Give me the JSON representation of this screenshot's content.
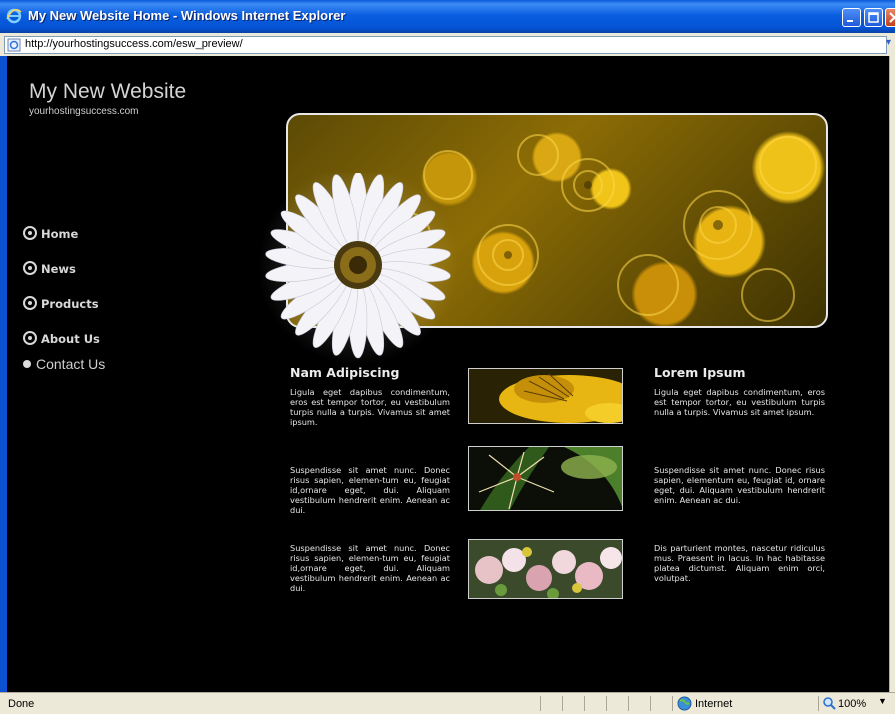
{
  "browser": {
    "window_title": "My New Website Home - Windows Internet Explorer",
    "address_url": "http://yourhostingsuccess.com/esw_preview/",
    "status_text": "Done",
    "zone_text": "Internet",
    "zoom_text": "100%"
  },
  "site": {
    "title": "My New Website",
    "subtitle": "yourhostingsuccess.com",
    "nav": [
      {
        "label": "Home"
      },
      {
        "label": "News"
      },
      {
        "label": "Products"
      },
      {
        "label": "About Us"
      }
    ],
    "subnav": [
      {
        "label": "Contact Us"
      }
    ],
    "left_column": {
      "heading": "Nam Adipiscing",
      "paragraphs": [
        "Ligula eget dapibus condimentum, eros est tempor tortor, eu vestibulum turpis nulla a turpis. Vivamus sit amet ipsum.",
        "Suspendisse sit amet nunc. Donec risus sapien, elemen-tum eu, feugiat id,ornare eget, dui. Aliquam vestibulum hendrerit enim. Aenean ac dui.",
        "Suspendisse sit amet nunc. Donec risus sapien, elemen-tum eu, feugiat id,ornare eget, dui. Aliquam vestibulum hendrerit enim. Aenean ac dui."
      ]
    },
    "right_column": {
      "heading": "Lorem Ipsum",
      "paragraphs": [
        "Ligula eget dapibus condimentum, eros est tempor tortor, eu vestibulum turpis nulla a turpis. Vivamus sit amet ipsum.",
        "Suspendisse sit amet nunc. Donec risus sapien, elementum eu, feugiat id, ornare eget, dui. Aliquam vestibulum hendrerit enim. Aenean ac dui.",
        "Dis parturient montes, nascetur ridiculus mus. Praesent in lacus. In hac habitasse platea dictumst. Aliquam enim orci, volutpat."
      ]
    },
    "colors": {
      "background": "#000000",
      "text": "#e6e6e6",
      "hero_yellow": "#f0c419"
    }
  }
}
